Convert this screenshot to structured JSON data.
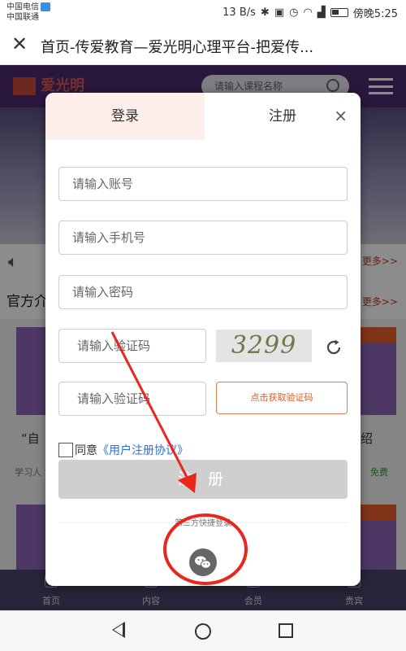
{
  "status_bar": {
    "carrier1": "中国电信",
    "carrier2": "中国联通",
    "speed": "13 B/s",
    "time": "傍晚5:25"
  },
  "titlebar": {
    "title": "首页-传爱教育—爱光明心理平台-把爱传..."
  },
  "site": {
    "logo_text": "爱光明",
    "search_placeholder": "请输入课程名称",
    "more": "更多>>",
    "section_title": "官方介",
    "text_left": "“自",
    "text_right": "绍",
    "learn": "学习人",
    "free": "免费",
    "nav": [
      "首页",
      "内容",
      "会员",
      "贵宾"
    ]
  },
  "modal": {
    "tab_login": "登录",
    "tab_register": "注册",
    "close": "×",
    "account_placeholder": "请输入账号",
    "phone_placeholder": "请输入手机号",
    "password_placeholder": "请输入密码",
    "captcha_placeholder": "请输入验证码",
    "captcha_code": "3299",
    "sms_placeholder": "请输入验证码",
    "get_code": "点击获取验证码",
    "agree_prefix": "同意",
    "agree_link": "《用户注册协议》",
    "register_button": "注 册",
    "third_party": "第三方快捷登录"
  },
  "icons": {
    "wechat": "wechat-icon",
    "refresh": "refresh-icon",
    "close": "close-icon"
  },
  "colors": {
    "accent_orange": "#e05a2a",
    "link_blue": "#2f6fd6",
    "annotation_red": "#e8281c",
    "site_purple": "#4e2a72"
  }
}
